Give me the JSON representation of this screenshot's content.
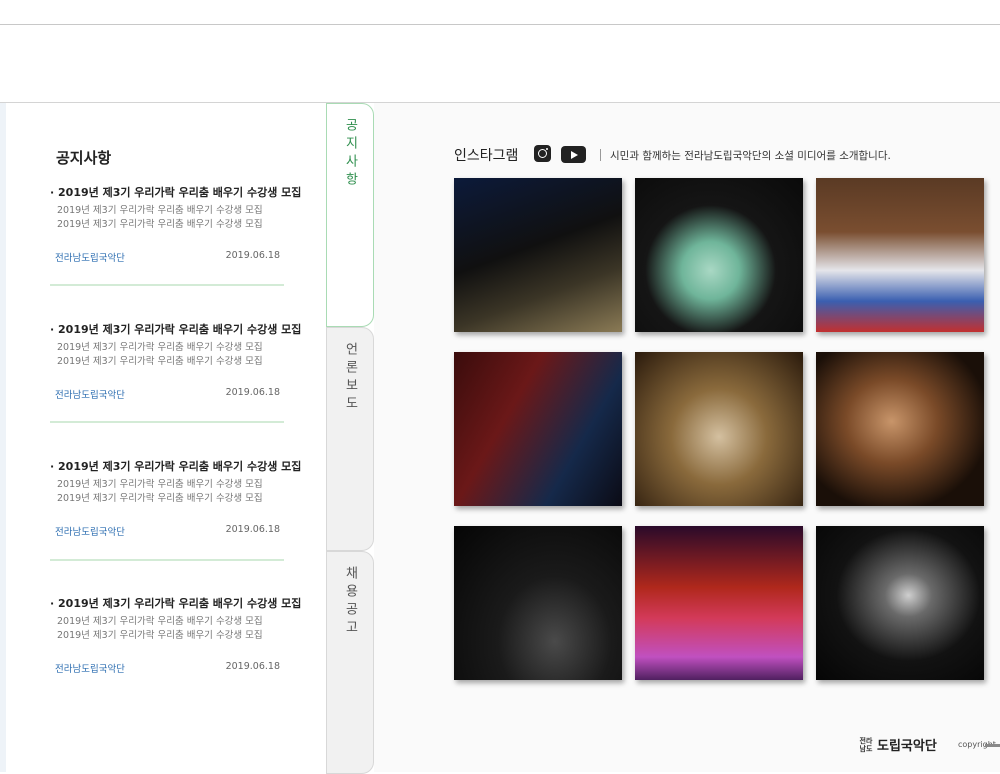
{
  "notices": {
    "title": "공지사항",
    "items": [
      {
        "title": "2019년 제3기 우리가락 우리춤 배우기 수강생 모집",
        "desc1": "2019년 제3기 우리가락 우리춤 배우기 수강생 모집",
        "desc2": "2019년 제3기 우리가락 우리춤 배우기 수강생 모집",
        "org": "전라남도립국악단",
        "date": "2019.06.18"
      },
      {
        "title": "2019년 제3기 우리가락 우리춤 배우기 수강생 모집",
        "desc1": "2019년 제3기 우리가락 우리춤 배우기 수강생 모집",
        "desc2": "2019년 제3기 우리가락 우리춤 배우기 수강생 모집",
        "org": "전라남도립국악단",
        "date": "2019.06.18"
      },
      {
        "title": "2019년 제3기 우리가락 우리춤 배우기 수강생 모집",
        "desc1": "2019년 제3기 우리가락 우리춤 배우기 수강생 모집",
        "desc2": "2019년 제3기 우리가락 우리춤 배우기 수강생 모집",
        "org": "전라남도립국악단",
        "date": "2019.06.18"
      },
      {
        "title": "2019년 제3기 우리가락 우리춤 배우기 수강생 모집",
        "desc1": "2019년 제3기 우리가락 우리춤 배우기 수강생 모집",
        "desc2": "2019년 제3기 우리가락 우리춤 배우기 수강생 모집",
        "org": "전라남도립국악단",
        "date": "2019.06.18"
      }
    ]
  },
  "tabs": [
    {
      "label": "공지사항",
      "active": true
    },
    {
      "label": "언론보도",
      "active": false
    },
    {
      "label": "채용공고",
      "active": false
    }
  ],
  "sns": {
    "title": "인스타그램",
    "icons": [
      "instagram-icon",
      "youtube-icon"
    ],
    "description": "시민과 함께하는 전라남도립국악단의 소셜 미디어를 소개합니다."
  },
  "footer": {
    "logo_small": "전라남도",
    "logo_main": "도립국악단",
    "copyright": "copyright"
  },
  "colors": {
    "accent_green": "#2f8f4e",
    "link_blue": "#2b6cb0",
    "separator": "#d3ebd6"
  }
}
